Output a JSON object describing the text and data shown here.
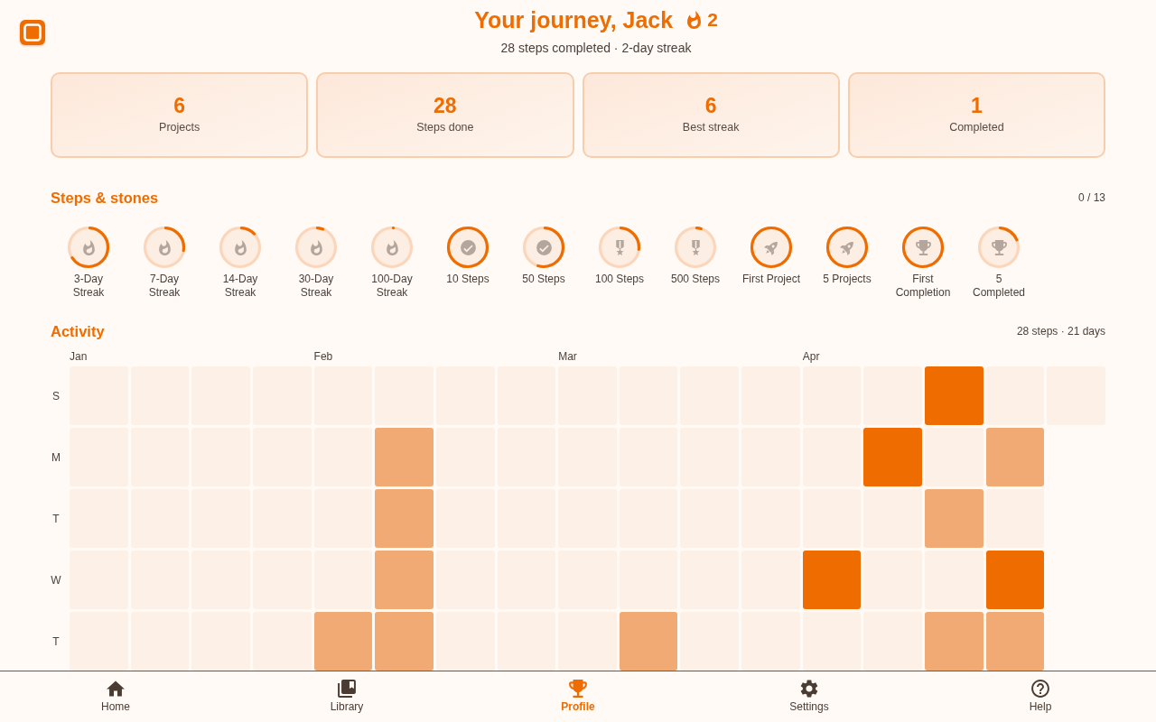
{
  "header": {
    "title": "Your journey, Jack",
    "streak_count": "2",
    "subtitle": "28 steps completed · 2-day streak"
  },
  "stats": [
    {
      "value": "6",
      "label": "Projects"
    },
    {
      "value": "28",
      "label": "Steps done"
    },
    {
      "value": "6",
      "label": "Best streak"
    },
    {
      "value": "1",
      "label": "Completed"
    }
  ],
  "achievements": {
    "title": "Steps & stones",
    "count": "0 / 13",
    "items": [
      {
        "label": "3-Day Streak",
        "kind": "flame",
        "level": 0.67
      },
      {
        "label": "7-Day Streak",
        "kind": "flame",
        "level": 0.29
      },
      {
        "label": "14-Day Streak",
        "kind": "flame",
        "level": 0.14
      },
      {
        "label": "30-Day Streak",
        "kind": "flame",
        "level": 0.07
      },
      {
        "label": "100-Day Streak",
        "kind": "flame",
        "level": 0.02
      },
      {
        "label": "10 Steps",
        "kind": "check",
        "level": 1
      },
      {
        "label": "50 Steps",
        "kind": "check",
        "level": 0.56
      },
      {
        "label": "100 Steps",
        "kind": "medal",
        "level": 0.28
      },
      {
        "label": "500 Steps",
        "kind": "medal",
        "level": 0.06
      },
      {
        "label": "First Project",
        "kind": "rocket",
        "level": 1
      },
      {
        "label": "5 Projects",
        "kind": "rocket",
        "level": 1
      },
      {
        "label": "First Completion",
        "kind": "trophy",
        "level": 1
      },
      {
        "label": "5 Completed",
        "kind": "trophy",
        "level": 0.2
      }
    ]
  },
  "activity": {
    "title": "Activity",
    "summary": "28 steps · 21 days",
    "day_labels": [
      "S",
      "M",
      "T",
      "W",
      "T"
    ],
    "months": [
      {
        "label": "Jan",
        "weeks": [
          {
            "days": [
              {
                "color": "#fdf0e6"
              },
              {
                "color": "#fdf0e6"
              },
              {
                "color": "#fdf0e6"
              },
              {
                "color": "#fdf0e6"
              },
              {
                "color": "#fdf0e6"
              }
            ]
          },
          {
            "days": [
              {
                "color": "#fdf0e6"
              },
              {
                "color": "#fdf0e6"
              },
              {
                "color": "#fdf0e6"
              },
              {
                "color": "#fdf0e6"
              },
              {
                "color": "#fdf0e6"
              }
            ]
          },
          {
            "days": [
              {
                "color": "#fdf0e6"
              },
              {
                "color": "#fdf0e6"
              },
              {
                "color": "#fdf0e6"
              },
              {
                "color": "#fdf0e6"
              },
              {
                "color": "#fdf0e6"
              }
            ]
          },
          {
            "days": [
              {
                "color": "#fdf0e6"
              },
              {
                "color": "#fdf0e6"
              },
              {
                "color": "#fdf0e6"
              },
              {
                "color": "#fdf0e6"
              },
              {
                "color": "#fdf0e6"
              }
            ]
          }
        ]
      },
      {
        "label": "Feb",
        "weeks": [
          {
            "days": [
              {
                "color": "#fdf0e6"
              },
              {
                "color": "#fdf0e6"
              },
              {
                "color": "#fdf0e6"
              },
              {
                "color": "#fdf0e6"
              },
              {
                "color": "#f1aa74"
              }
            ]
          },
          {
            "days": [
              {
                "color": "#fdf0e6"
              },
              {
                "color": "#f1aa74"
              },
              {
                "color": "#f1aa74"
              },
              {
                "color": "#f1aa74"
              },
              {
                "color": "#f1aa74"
              }
            ]
          },
          {
            "days": [
              {
                "color": "#fdf0e6"
              },
              {
                "color": "#fdf0e6"
              },
              {
                "color": "#fdf0e6"
              },
              {
                "color": "#fdf0e6"
              },
              {
                "color": "#fdf0e6"
              }
            ]
          },
          {
            "days": [
              {
                "color": "#fdf0e6"
              },
              {
                "color": "#fdf0e6"
              },
              {
                "color": "#fdf0e6"
              },
              {
                "color": "#fdf0e6"
              },
              {
                "color": "#fdf0e6"
              }
            ]
          }
        ]
      },
      {
        "label": "Mar",
        "weeks": [
          {
            "days": [
              {
                "color": "#fdf0e6"
              },
              {
                "color": "#fdf0e6"
              },
              {
                "color": "#fdf0e6"
              },
              {
                "color": "#fdf0e6"
              },
              {
                "color": "#fdf0e6"
              }
            ]
          },
          {
            "days": [
              {
                "color": "#fdf0e6"
              },
              {
                "color": "#fdf0e6"
              },
              {
                "color": "#fdf0e6"
              },
              {
                "color": "#fdf0e6"
              },
              {
                "color": "#f1aa74"
              }
            ]
          },
          {
            "days": [
              {
                "color": "#fdf0e6"
              },
              {
                "color": "#fdf0e6"
              },
              {
                "color": "#fdf0e6"
              },
              {
                "color": "#fdf0e6"
              },
              {
                "color": "#fdf0e6"
              }
            ]
          },
          {
            "days": [
              {
                "color": "#fdf0e6"
              },
              {
                "color": "#fdf0e6"
              },
              {
                "color": "#fdf0e6"
              },
              {
                "color": "#fdf0e6"
              },
              {
                "color": "#fdf0e6"
              }
            ]
          }
        ]
      },
      {
        "label": "Apr",
        "weeks": [
          {
            "days": [
              {
                "color": "#fdf0e6"
              },
              {
                "color": "#fdf0e6"
              },
              {
                "color": "#fdf0e6"
              },
              {
                "color": "#ef6c00"
              },
              {
                "color": "#fdf0e6"
              }
            ]
          },
          {
            "days": [
              {
                "color": "#fdf0e6"
              },
              {
                "color": "#ef6c00"
              },
              {
                "color": "#fdf0e6"
              },
              {
                "color": "#fdf0e6"
              },
              {
                "color": "#fdf0e6"
              }
            ]
          },
          {
            "days": [
              {
                "color": "#ef6c00"
              },
              {
                "color": "#fdf0e6"
              },
              {
                "color": "#f1aa74"
              },
              {
                "color": "#fdf0e6"
              },
              {
                "color": "#f1aa74"
              }
            ]
          },
          {
            "days": [
              {
                "color": "#fdf0e6"
              },
              {
                "color": "#f1aa74"
              },
              {
                "color": "#fdf0e6"
              },
              {
                "color": "#ef6c00"
              },
              {
                "color": "#f1aa74"
              }
            ]
          },
          {
            "days": [
              {
                "color": "#fdf0e6"
              }
            ]
          }
        ]
      }
    ]
  },
  "nav": [
    {
      "label": "Home",
      "kind": "home",
      "selected": false
    },
    {
      "label": "Library",
      "kind": "library",
      "selected": false
    },
    {
      "label": "Profile",
      "kind": "trophy",
      "selected": true
    },
    {
      "label": "Settings",
      "kind": "gear",
      "selected": false
    },
    {
      "label": "Help",
      "kind": "help",
      "selected": false
    }
  ]
}
